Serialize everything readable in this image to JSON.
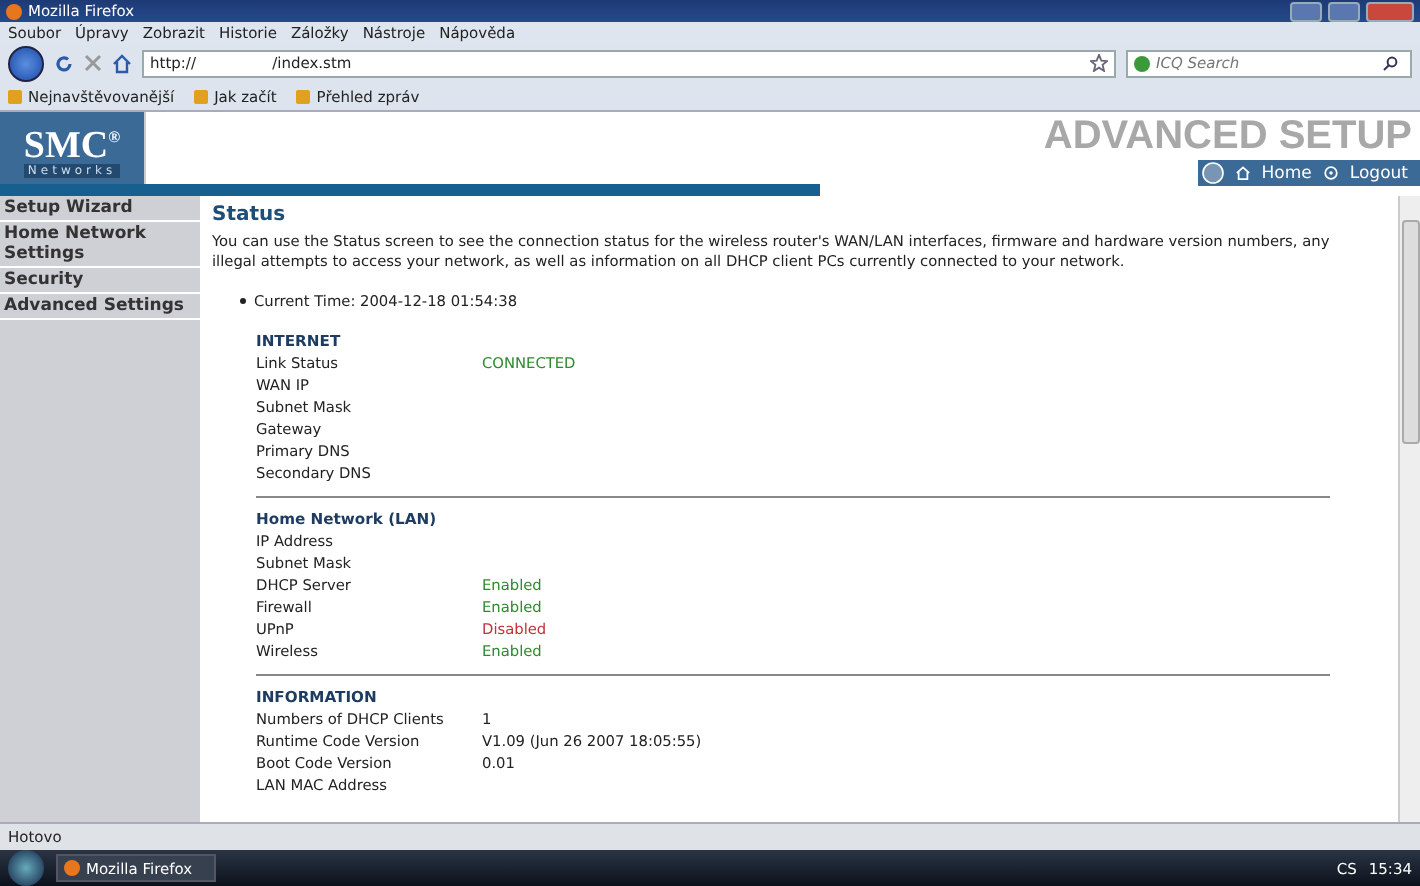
{
  "window": {
    "title": "Mozilla Firefox"
  },
  "menu": [
    "Soubor",
    "Úpravy",
    "Zobrazit",
    "Historie",
    "Záložky",
    "Nástroje",
    "Nápověda"
  ],
  "address": {
    "value": "http://                /index.stm"
  },
  "search": {
    "placeholder": "ICQ Search"
  },
  "bookmarks": [
    "Nejnavštěvovanější",
    "Jak začít",
    "Přehled zpráv"
  ],
  "header": {
    "logo": "SMC",
    "logo_mark": "®",
    "logo_sub": "Networks",
    "title": "ADVANCED SETUP",
    "home": "Home",
    "logout": "Logout"
  },
  "sidebar": {
    "items": [
      "Setup Wizard",
      "Home Network Settings",
      "Security",
      "Advanced Settings"
    ]
  },
  "page": {
    "title": "Status",
    "intro": "You can use the Status screen to see the connection status for the wireless router's WAN/LAN interfaces, firmware and hardware version numbers, any illegal attempts to access your network, as well as information on all DHCP client PCs currently connected to your network.",
    "current_time": "Current Time: 2004-12-18 01:54:38",
    "sections": [
      {
        "title": "INTERNET",
        "rows": [
          {
            "label": "Link Status",
            "value": "CONNECTED",
            "kind": "good"
          },
          {
            "label": "WAN IP"
          },
          {
            "label": "Subnet Mask"
          },
          {
            "label": "Gateway"
          },
          {
            "label": "Primary DNS"
          },
          {
            "label": "Secondary DNS"
          }
        ]
      },
      {
        "title": "Home Network (LAN)",
        "rows": [
          {
            "label": "IP Address"
          },
          {
            "label": "Subnet Mask"
          },
          {
            "label": "DHCP Server",
            "value": "Enabled",
            "kind": "good"
          },
          {
            "label": "Firewall",
            "value": "Enabled",
            "kind": "good"
          },
          {
            "label": "UPnP",
            "value": "Disabled",
            "kind": "bad"
          },
          {
            "label": "Wireless",
            "value": "Enabled",
            "kind": "good"
          }
        ]
      },
      {
        "title": "INFORMATION",
        "rows": [
          {
            "label": "Numbers of DHCP Clients",
            "value": "1",
            "kind": "plain"
          },
          {
            "label": "Runtime Code Version",
            "value": "V1.09 (Jun 26 2007 18:05:55)",
            "kind": "plain"
          },
          {
            "label": "Boot Code Version",
            "value": "0.01",
            "kind": "plain"
          },
          {
            "label": "LAN MAC Address"
          }
        ]
      }
    ]
  },
  "status_bar": {
    "text": "Hotovo"
  },
  "taskbar": {
    "task": "Mozilla Firefox",
    "language": "CS",
    "clock": "15:34"
  }
}
